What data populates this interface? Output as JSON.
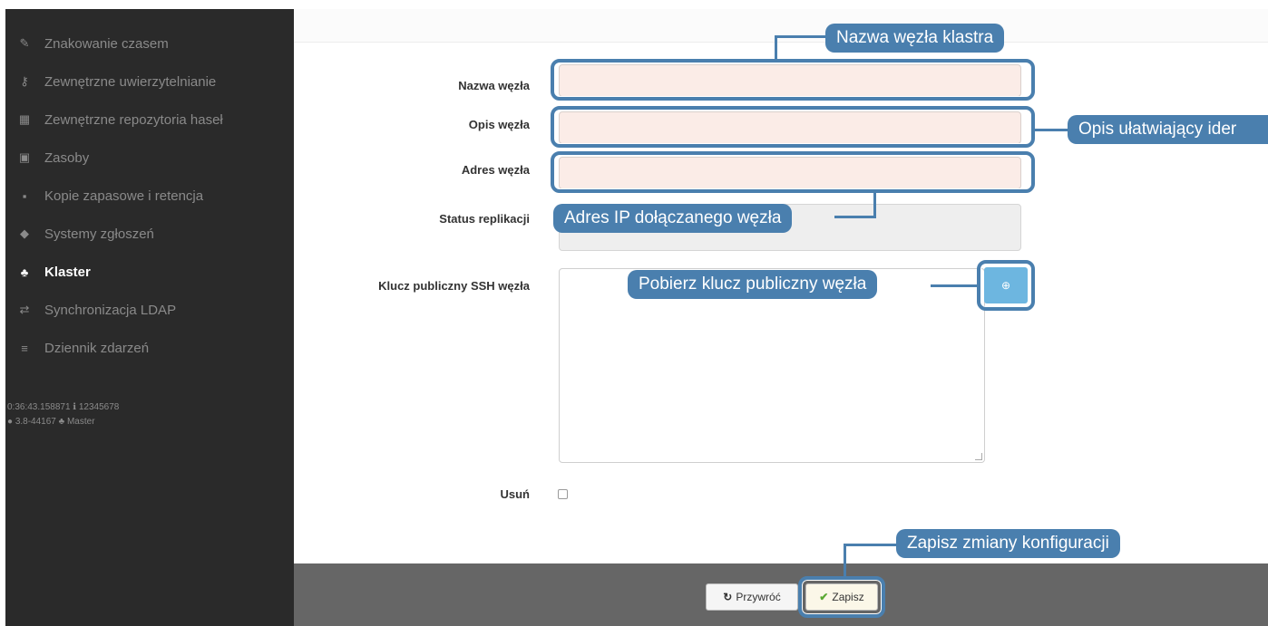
{
  "sidebar": {
    "items": [
      {
        "icon": "edit-icon",
        "glyph": "✎",
        "label": "Znakowanie czasem",
        "active": false
      },
      {
        "icon": "key-icon",
        "glyph": "⚷",
        "label": "Zewnętrzne uwierzytelnianie",
        "active": false
      },
      {
        "icon": "grid-icon",
        "glyph": "▦",
        "label": "Zewnętrzne repozytoria haseł",
        "active": false
      },
      {
        "icon": "image-icon",
        "glyph": "▣",
        "label": "Zasoby",
        "active": false
      },
      {
        "icon": "archive-icon",
        "glyph": "▪",
        "label": "Kopie zapasowe i retencja",
        "active": false
      },
      {
        "icon": "ticket-icon",
        "glyph": "◆",
        "label": "Systemy zgłoszeń",
        "active": false
      },
      {
        "icon": "sitemap-icon",
        "glyph": "♣",
        "label": "Klaster",
        "active": true
      },
      {
        "icon": "exchange-icon",
        "glyph": "⇄",
        "label": "Synchronizacja LDAP",
        "active": false
      },
      {
        "icon": "list-icon",
        "glyph": "≡",
        "label": "Dziennik zdarzeń",
        "active": false
      }
    ],
    "system_info": {
      "line1": "0:36:43.158871   ℹ 12345678",
      "line2": "● 3.8-44167   ♣ Master"
    }
  },
  "form": {
    "node_name_label": "Nazwa węzła",
    "node_name_value": "",
    "node_desc_label": "Opis węzła",
    "node_desc_value": "",
    "node_address_label": "Adres węzła",
    "node_address_value": "",
    "replication_status_label": "Status replikacji",
    "ssh_key_label": "Klucz publiczny SSH węzła",
    "delete_label": "Usuń",
    "delete_checked": false
  },
  "footer": {
    "revert_label": "Przywróć",
    "save_label": "Zapisz"
  },
  "callouts": {
    "node_name": "Nazwa węzła klastra",
    "node_desc": "Opis ułatwiający ider",
    "node_address": "Adres IP dołączanego węzła",
    "download_key": "Pobierz klucz publiczny węzła",
    "save": "Zapisz zmiany konfiguracji"
  },
  "colors": {
    "accent": "#4a7fae",
    "sidebar_bg": "#2a2a2a",
    "input_bg": "#fbece7",
    "footer_bg": "#666666",
    "save_check": "#5aa832"
  }
}
